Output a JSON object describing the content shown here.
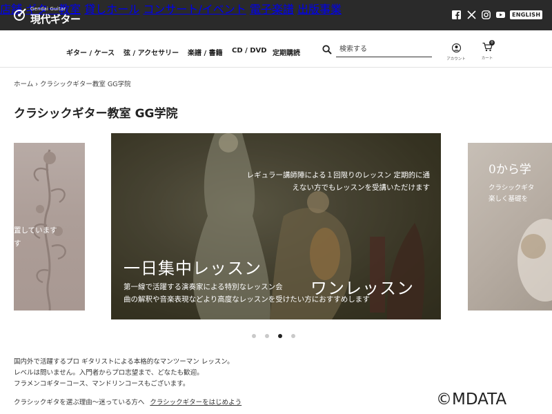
{
  "brand": {
    "logo_sub": "Gendai Guitar",
    "logo_main": "現代ギター"
  },
  "top_nav": [
    "店舗",
    "ギター教室",
    "貸しホール",
    "コンサート/イベント",
    "電子楽譜",
    "出版事業"
  ],
  "social": {
    "icons": [
      "facebook-icon",
      "x-icon",
      "instagram-icon",
      "youtube-icon"
    ],
    "english_label": "ENGLISH"
  },
  "sub_nav": [
    "ギター / ケース",
    "弦 / アクセサリー",
    "楽譜 / 書籍",
    "CD / DVD",
    "定期購読"
  ],
  "search": {
    "placeholder": "検索する"
  },
  "account": {
    "label": "アカウント"
  },
  "cart": {
    "label": "カート",
    "count": "0"
  },
  "breadcrumb": {
    "home": "ホーム",
    "separator": "›",
    "current": "クラシックギター教室 GG学院"
  },
  "page": {
    "title": "クラシックギター教室 GG学院"
  },
  "carousel": {
    "left_slide": {
      "line1": "置しています",
      "line2": "す"
    },
    "main_slide": {
      "heading1": "ワンレッスン",
      "body1": "レギュラー講師陣による１回限りのレッスン 定期的に通えない方でもレッスンを受講いただけます",
      "heading2": "一日集中レッスン",
      "body2_line1": "第一線で活躍する演奏家による特別なレッスン会",
      "body2_line2": "曲の解釈や音楽表現などより高度なレッスンを受けたい方におすすめします"
    },
    "right_slide": {
      "heading": "0から学",
      "line1": "クラシックギタ",
      "line2": "楽しく基礎を"
    },
    "dots": 4,
    "active_index": 2
  },
  "description": {
    "line1": "国内外で活躍するプロ ギタリストによる本格的なマンツーマン レッスン。",
    "line2": "レベルは問いません。入門者からプロ志望まで、どなたも歓迎。",
    "line3": "フラメンコギターコース、マンドリンコースもございます。"
  },
  "links": {
    "prompt": "クラシックギタを選ぶ理由〜迷っている方へ",
    "link": "クラシックギターをはじめよう"
  },
  "watermark": "©MDATA"
}
